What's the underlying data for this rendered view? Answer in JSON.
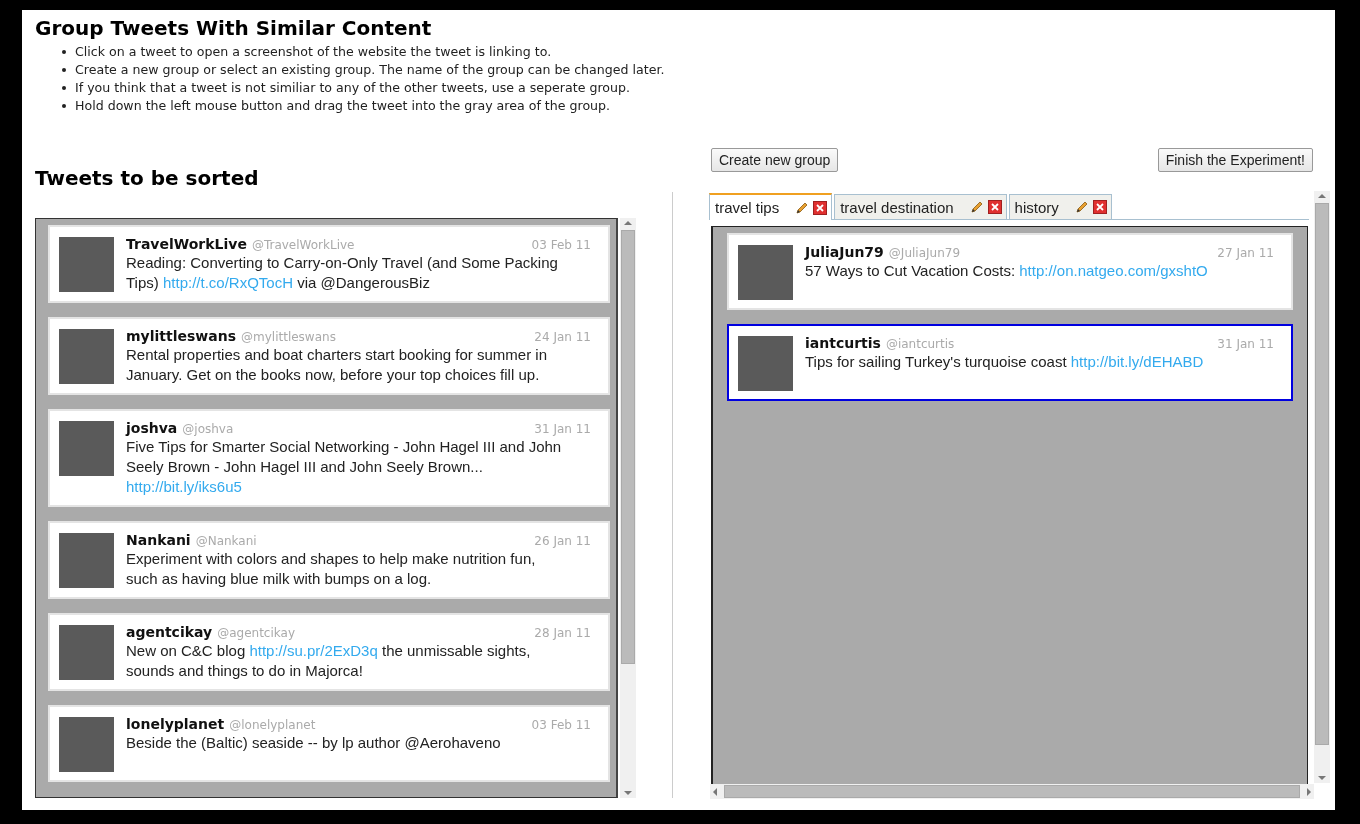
{
  "title": "Group Tweets With Similar Content",
  "instructions": [
    "Click on a tweet to open a screenshot of the website the tweet is linking to.",
    "Create a new group or select an existing group. The name of the group can be changed later.",
    "If you think that a tweet is not similiar to any of the other tweets, use a seperate group.",
    "Hold down the left mouse button and drag the tweet into the gray area of the group."
  ],
  "unsorted": {
    "heading": "Tweets to be sorted",
    "tweets": [
      {
        "name": "TravelWorkLive",
        "handle": "@TravelWorkLive",
        "date": "03 Feb 11",
        "parts": [
          {
            "kind": "text",
            "text": "Reading: Converting to Carry-on-Only Travel (and Some Packing Tips) "
          },
          {
            "kind": "link",
            "text": "http://t.co/RxQTocH"
          },
          {
            "kind": "text",
            "text": " via @DangerousBiz"
          }
        ]
      },
      {
        "name": "mylittleswans",
        "handle": "@mylittleswans",
        "date": "24 Jan 11",
        "parts": [
          {
            "kind": "text",
            "text": "Rental properties and boat charters start booking for summer in January. Get on the books now, before your top choices fill up."
          }
        ]
      },
      {
        "name": "joshva",
        "handle": "@joshva",
        "date": "31 Jan 11",
        "parts": [
          {
            "kind": "text",
            "text": "Five Tips for Smarter Social Networking - John Hagel III and John Seely Brown - John Hagel III and John Seely Brown... "
          },
          {
            "kind": "link",
            "text": "http://bit.ly/iks6u5"
          }
        ]
      },
      {
        "name": "Nankani",
        "handle": "@Nankani",
        "date": "26 Jan 11",
        "parts": [
          {
            "kind": "text",
            "text": "Experiment with colors and shapes to help make nutrition fun, such as having blue milk with bumps on a log."
          }
        ]
      },
      {
        "name": "agentcikay",
        "handle": "@agentcikay",
        "date": "28 Jan 11",
        "parts": [
          {
            "kind": "text",
            "text": "New on C&C blog "
          },
          {
            "kind": "link",
            "text": "http://su.pr/2ExD3q"
          },
          {
            "kind": "text",
            "text": " the unmissable sights, sounds and things to do in Majorca!"
          }
        ]
      },
      {
        "name": "lonelyplanet",
        "handle": "@lonelyplanet",
        "date": "03 Feb 11",
        "parts": [
          {
            "kind": "text",
            "text": "Beside the (Baltic) seaside -- by lp author @Aerohaveno"
          }
        ]
      }
    ]
  },
  "buttons": {
    "create": "Create new group",
    "finish": "Finish the Experiment!"
  },
  "groups": [
    {
      "label": "travel tips",
      "selected": true
    },
    {
      "label": "travel destination",
      "selected": false
    },
    {
      "label": "history",
      "selected": false
    }
  ],
  "group_tweets": [
    {
      "name": "JuliaJun79",
      "handle": "@JuliaJun79",
      "date": "27 Jan 11",
      "selected": false,
      "parts": [
        {
          "kind": "text",
          "text": "57 Ways to Cut Vacation Costs: "
        },
        {
          "kind": "link",
          "text": "http://on.natgeo.com/gxshtO"
        }
      ]
    },
    {
      "name": "iantcurtis",
      "handle": "@iantcurtis",
      "date": "31 Jan 11",
      "selected": true,
      "parts": [
        {
          "kind": "text",
          "text": "Tips for sailing Turkey's turquoise coast "
        },
        {
          "kind": "link",
          "text": "http://bit.ly/dEHABD"
        }
      ]
    }
  ]
}
